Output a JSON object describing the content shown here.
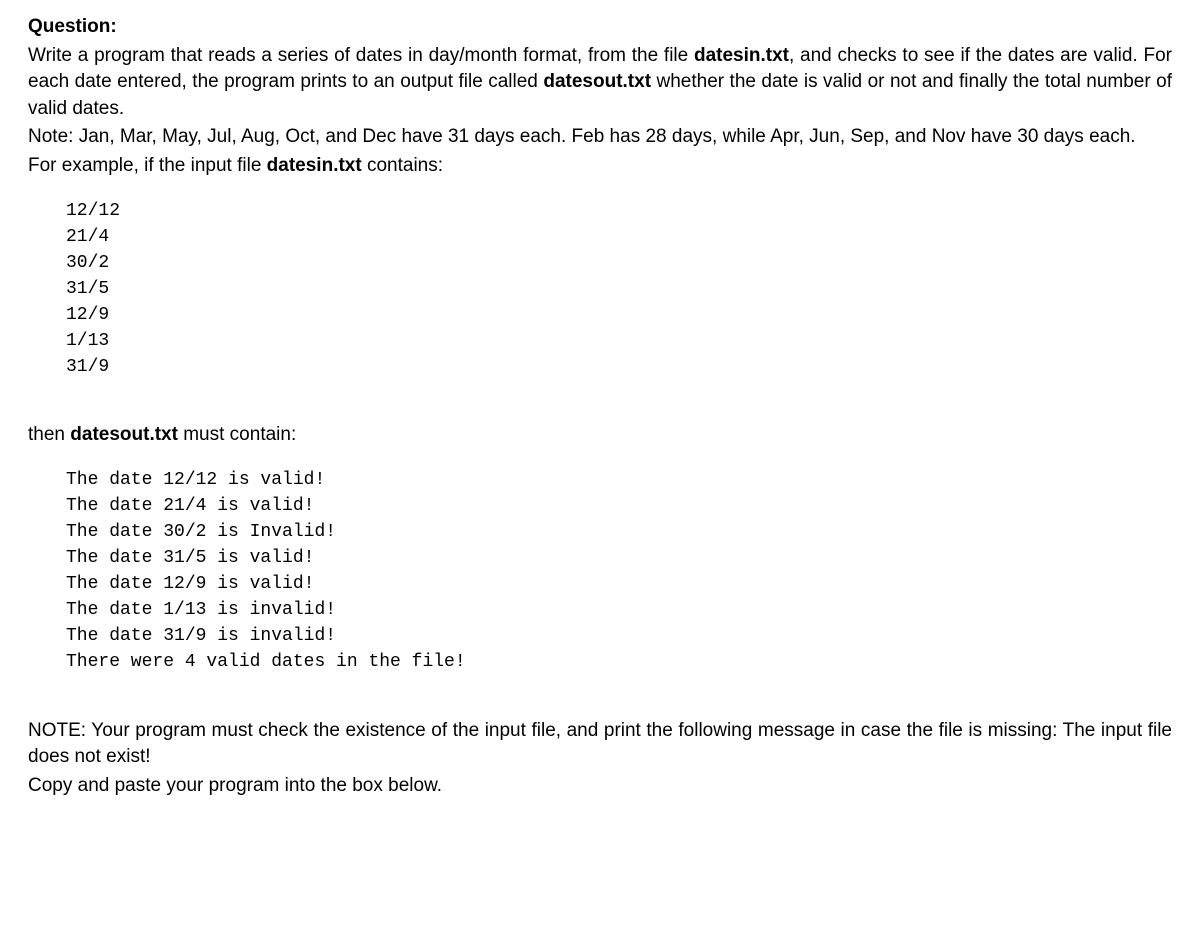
{
  "heading": "Question:",
  "paragraph1_part1": "Write a program that reads a series of dates in day/month format, from the file ",
  "paragraph1_file1": "datesin.txt",
  "paragraph1_part2": ", and checks to see if the dates are valid. For each date entered, the program prints to an output file called ",
  "paragraph1_file2": "datesout.txt",
  "paragraph1_part3": " whether the date is valid or not and finally the total number of valid dates.",
  "paragraph2": "Note: Jan, Mar, May, Jul, Aug, Oct, and Dec have 31 days each. Feb has 28 days, while Apr, Jun, Sep, and Nov have 30 days each.",
  "paragraph3_part1": "For example, if the input file ",
  "paragraph3_file": "datesin.txt",
  "paragraph3_part2": " contains:",
  "input_data": "12/12\n21/4\n30/2\n31/5\n12/9\n1/13\n31/9",
  "paragraph4_part1": "then ",
  "paragraph4_file": "datesout.txt",
  "paragraph4_part2": " must contain:",
  "output_data": "The date 12/12 is valid!\nThe date 21/4 is valid!\nThe date 30/2 is Invalid!\nThe date 31/5 is valid!\nThe date 12/9 is valid!\nThe date 1/13 is invalid!\nThe date 31/9 is invalid!\nThere were 4 valid dates in the file!",
  "note_paragraph": "NOTE: Your program must check the existence of the input file, and print the following message in case the file is missing: The input file does not exist!",
  "final_paragraph": "Copy and paste your program into the box below."
}
